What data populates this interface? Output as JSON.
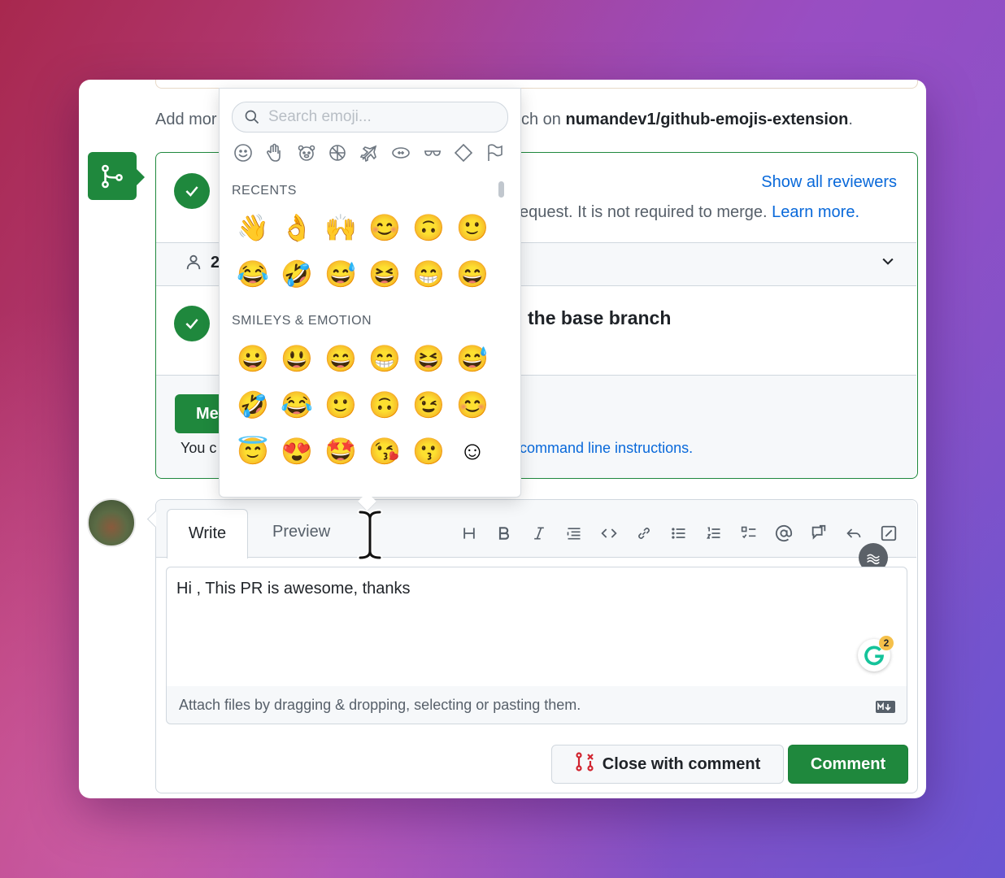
{
  "header": {
    "add_more_prefix": "Add mor",
    "branch_prefix": "ch on",
    "repo_name": "numandev1/github-emojis-extension",
    "period": "."
  },
  "reviews": {
    "show_all_reviewers": "Show all reviewers",
    "not_required_text": "equest. It is not required to merge.",
    "learn_more": "Learn more.",
    "reviewer_count": "2"
  },
  "branch_status": {
    "title": "the base branch"
  },
  "merge": {
    "button_label": "Me",
    "you_can_text": "You c",
    "command_line_link": "command line instructions."
  },
  "emoji_picker": {
    "search_placeholder": "Search emoji...",
    "categories": [
      "smileys-icon",
      "hand-icon",
      "animal-icon",
      "food-icon",
      "travel-icon",
      "activity-icon",
      "objects-icon",
      "symbols-icon",
      "flags-icon"
    ],
    "recents_title": "RECENTS",
    "recents": [
      "👋",
      "👌",
      "🙌",
      "😊",
      "🙃",
      "🙂",
      "😂",
      "🤣",
      "😅",
      "😆",
      "😁",
      "😄"
    ],
    "smileys_title": "SMILEYS & EMOTION",
    "smileys": [
      "😀",
      "😃",
      "😄",
      "😁",
      "😆",
      "😅",
      "🤣",
      "😂",
      "🙂",
      "🙃",
      "😉",
      "😊",
      "😇",
      "😍",
      "🤩",
      "😘",
      "😗",
      "☺"
    ]
  },
  "comment": {
    "tab_write": "Write",
    "tab_preview": "Preview",
    "text": "Hi , This PR is awesome, thanks",
    "attach_text": "Attach files by dragging & dropping, selecting or pasting them.",
    "grammarly_count": "2",
    "close_with_comment": "Close with comment",
    "comment_button": "Comment"
  },
  "colors": {
    "green": "#1f883d",
    "link": "#0969da",
    "text": "#1f2328",
    "muted": "#57606a"
  }
}
